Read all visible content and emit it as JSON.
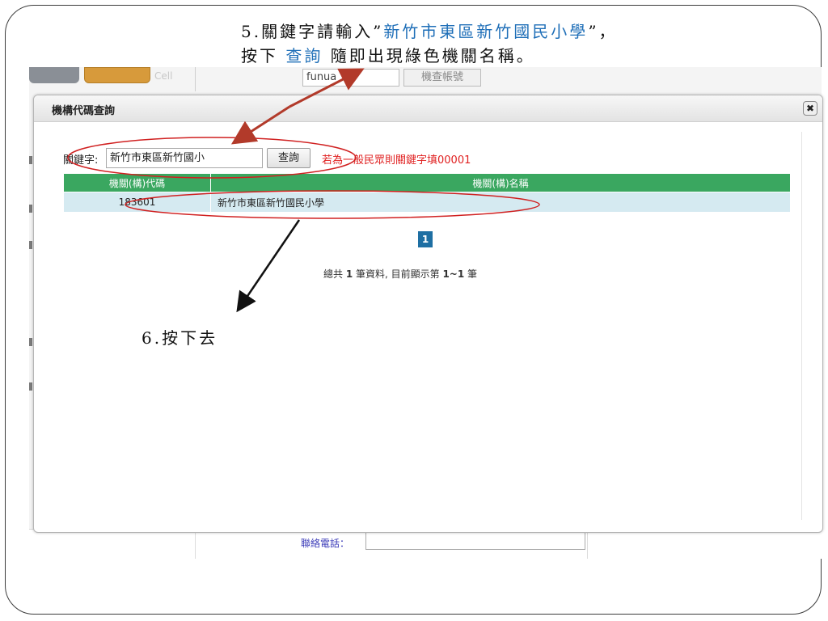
{
  "instruction": {
    "line1_pre": "5.關鍵字請輸入”",
    "line1_keyword": "新竹市東區新竹國民小學",
    "line1_post": "”，",
    "line2_pre": "按下 ",
    "line2_button": "查詢",
    "line2_post": " 隨即出現綠色機關名稱。"
  },
  "background_page": {
    "top_input_value": "funua",
    "top_button_label": "機查帳號",
    "top_faded_text": "Cell",
    "contact_label": "聯絡電話："
  },
  "modal": {
    "title": "機構代碼查詢",
    "close_glyph": "✖",
    "keyword_label": "關鍵字:",
    "keyword_value": "新竹市東區新竹國小",
    "search_button": "查詢",
    "hint": "若為一般民眾則關鍵字填00001",
    "table": {
      "headers": [
        "機關(構)代碼",
        "機關(構)名稱"
      ],
      "rows": [
        {
          "code": "183601",
          "name": "新竹市東區新竹國民小學"
        }
      ]
    },
    "pager_current": "1",
    "summary": {
      "prefix": "總共 ",
      "total": "1",
      "middle": " 筆資料, 目前顯示第 ",
      "range": "1~1",
      "suffix": " 筆"
    }
  },
  "annotation_note": "6.按下去",
  "colors": {
    "header_green": "#3aa760",
    "row_blue": "#d5eaf1",
    "annotation_red": "#d02020",
    "arrow_brown": "#b23a2a",
    "instruction_blue": "#1f6fb8",
    "pager_blue": "#1e6fa3"
  }
}
